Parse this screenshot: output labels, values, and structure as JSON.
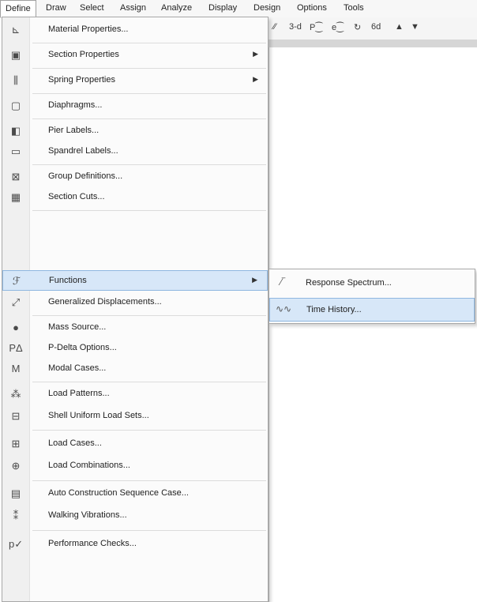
{
  "menubar": {
    "items": [
      "Define",
      "Draw",
      "Select",
      "Assign",
      "Analyze",
      "Display",
      "Design",
      "Options",
      "Tools"
    ]
  },
  "toolbar": {
    "icons": [
      "3-d",
      "Plan",
      "Elevation"
    ]
  },
  "define_menu": {
    "items": [
      {
        "label": "Material Properties...",
        "icon": "material-icon"
      },
      {
        "label": "Section Properties",
        "icon": "section-icon",
        "submenu": true
      },
      {
        "label": "Spring Properties",
        "icon": "spring-icon",
        "submenu": true
      },
      {
        "label": "Diaphragms...",
        "icon": "diaphragm-icon"
      },
      {
        "label": "Pier Labels...",
        "icon": "pier-icon"
      },
      {
        "label": "Spandrel Labels...",
        "icon": "spandrel-icon"
      },
      {
        "label": "Group Definitions...",
        "icon": "group-icon"
      },
      {
        "label": "Section Cuts...",
        "icon": "section-cut-icon"
      },
      {
        "label": "Functions",
        "icon": "functions-icon",
        "submenu": true,
        "highlighted": true
      },
      {
        "label": "Generalized Displacements...",
        "icon": "displacement-icon"
      },
      {
        "label": "Mass Source...",
        "icon": "mass-icon"
      },
      {
        "label": "P-Delta Options...",
        "icon": "pdelta-icon"
      },
      {
        "label": "Modal Cases...",
        "icon": "modal-icon"
      },
      {
        "label": "Load Patterns...",
        "icon": "load-pattern-icon"
      },
      {
        "label": "Shell Uniform Load Sets...",
        "icon": "shell-load-icon"
      },
      {
        "label": "Load Cases...",
        "icon": "load-case-icon"
      },
      {
        "label": "Load Combinations...",
        "icon": "load-combo-icon"
      },
      {
        "label": "Auto Construction Sequence Case...",
        "icon": "construction-icon"
      },
      {
        "label": "Walking Vibrations...",
        "icon": "walking-icon"
      },
      {
        "label": "Performance Checks...",
        "icon": "performance-icon"
      }
    ]
  },
  "functions_submenu": {
    "items": [
      {
        "label": "Response Spectrum...",
        "icon": "spectrum-icon"
      },
      {
        "label": "Time History...",
        "icon": "time-history-icon",
        "highlighted": true
      }
    ]
  }
}
